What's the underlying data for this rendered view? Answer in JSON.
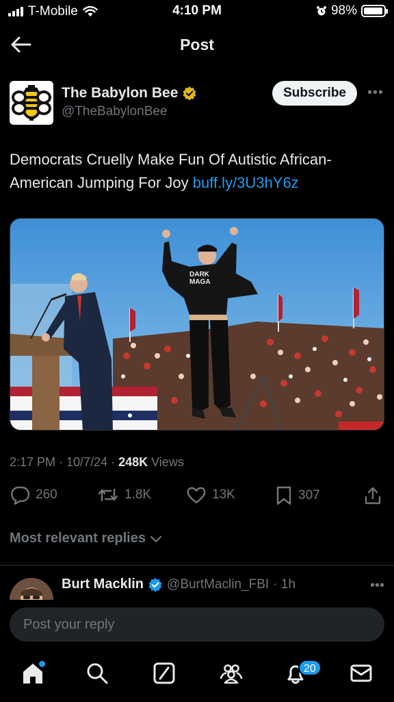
{
  "status_bar": {
    "carrier": "T-Mobile",
    "time": "4:10 PM",
    "battery": "98%",
    "battery_level": 0.98
  },
  "header": {
    "title": "Post"
  },
  "post": {
    "author_name": "The Babylon Bee",
    "author_handle": "@TheBabylonBee",
    "subscribe_label": "Subscribe",
    "text": "Democrats Cruelly Make Fun Of Autistic African-American Jumping For Joy ",
    "link_text": "buff.ly/3U3hY6z",
    "timestamp": "2:17 PM · 10/7/24 · ",
    "views_count": "248K",
    "views_label": " Views",
    "stats": {
      "replies": "260",
      "reposts": "1.8K",
      "likes": "13K",
      "bookmarks": "307"
    }
  },
  "replies": {
    "sort_label": "Most relevant replies",
    "items": [
      {
        "name": "Burt Macklin",
        "handle": "@BurtMaclin_FBI",
        "age": "· 1h"
      }
    ]
  },
  "reply_input": {
    "placeholder": "Post your reply"
  },
  "tab_bar": {
    "notification_count": "20"
  },
  "colors": {
    "accent": "#1d9bf0",
    "background": "#000000",
    "muted": "#71767b",
    "verified_gold": "#e2b719"
  }
}
